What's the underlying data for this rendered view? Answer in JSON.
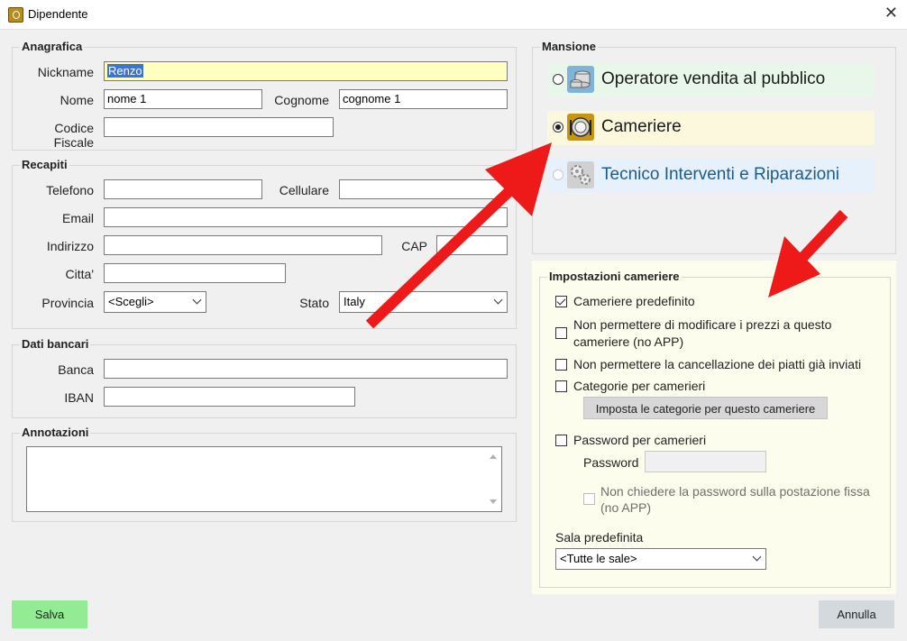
{
  "window": {
    "title": "Dipendente",
    "close_glyph": "✕"
  },
  "anagrafica": {
    "legend": "Anagrafica",
    "nickname_label": "Nickname",
    "nickname_value": "Renzo",
    "nome_label": "Nome",
    "nome_value": "nome 1",
    "cognome_label": "Cognome",
    "cognome_value": "cognome 1",
    "cf_label": "Codice Fiscale",
    "cf_value": ""
  },
  "recapiti": {
    "legend": "Recapiti",
    "telefono_label": "Telefono",
    "cellulare_label": "Cellulare",
    "email_label": "Email",
    "indirizzo_label": "Indirizzo",
    "cap_label": "CAP",
    "citta_label": "Citta'",
    "provincia_label": "Provincia",
    "provincia_value": "<Scegli>",
    "stato_label": "Stato",
    "stato_value": "Italy"
  },
  "bancari": {
    "legend": "Dati bancari",
    "banca_label": "Banca",
    "iban_label": "IBAN"
  },
  "annotazioni": {
    "legend": "Annotazioni"
  },
  "mansione": {
    "legend": "Mansione",
    "options": [
      {
        "label": "Operatore vendita al pubblico",
        "icon": "coins-icon",
        "selected": false,
        "color": "#1a1a1a",
        "bg": "#e9f7ea"
      },
      {
        "label": "Cameriere",
        "icon": "waiter-icon",
        "selected": true,
        "color": "#1a1a1a",
        "bg": "#fbf8de"
      },
      {
        "label": "Tecnico Interventi e Riparazioni",
        "icon": "gears-icon",
        "selected": false,
        "color": "#1d5b8f",
        "bg": "#e6f1fb"
      }
    ]
  },
  "impostazioni": {
    "legend": "Impostazioni cameriere",
    "cameriere_predefinito": "Cameriere predefinito",
    "no_prezzi_1": "Non permettere di modificare i prezzi a questo",
    "no_prezzi_2": "cameriere (no APP)",
    "no_cancellazione": "Non permettere la cancellazione dei piatti già inviati",
    "categorie": "Categorie per camerieri",
    "imposta_categorie_button": "Imposta le categorie per questo cameriere",
    "password_camerieri": "Password per camerieri",
    "password_label": "Password",
    "non_chiedere_1": "Non chiedere la password sulla postazione fissa",
    "non_chiedere_2": "(no APP)",
    "sala_label": "Sala predefinita",
    "sala_value": "<Tutte le sale>"
  },
  "footer": {
    "salva": "Salva",
    "annulla": "Annulla"
  },
  "colors": {
    "salva_bg": "#93ec93",
    "annulla_bg": "#d4d9de",
    "arrow": "#ee1a1a",
    "panel_bg": "#fdfdee"
  }
}
